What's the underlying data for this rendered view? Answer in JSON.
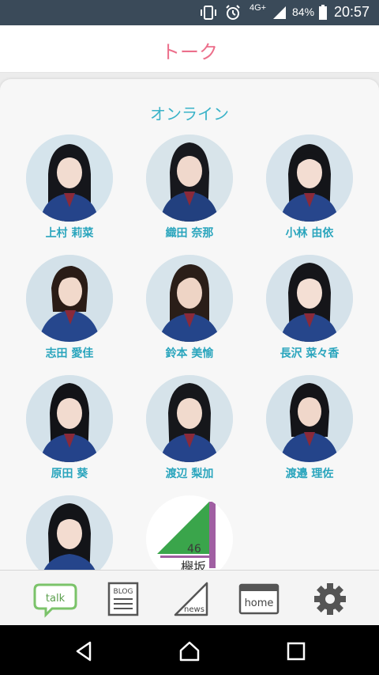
{
  "status_bar": {
    "network": "4G+",
    "battery": "84%",
    "time": "20:57",
    "icons": [
      "vibrate-icon",
      "alarm-icon",
      "signal-icon",
      "battery-icon"
    ]
  },
  "header": {
    "title": "トーク"
  },
  "section": {
    "title": "オンライン"
  },
  "members": [
    {
      "name": "上村 莉菜"
    },
    {
      "name": "織田 奈那"
    },
    {
      "name": "小林 由依"
    },
    {
      "name": "志田 愛佳"
    },
    {
      "name": "鈴本 美愉"
    },
    {
      "name": "長沢 菜々香"
    },
    {
      "name": "原田 葵"
    },
    {
      "name": "渡辺 梨加"
    },
    {
      "name": "渡邉 理佐"
    },
    {
      "name": ""
    }
  ],
  "logo": {
    "number": "46",
    "text": "欅坂"
  },
  "tabs": [
    {
      "label": "talk",
      "icon": "talk-icon"
    },
    {
      "label": "BLOG",
      "icon": "blog-icon"
    },
    {
      "label": "news",
      "icon": "news-icon"
    },
    {
      "label": "home",
      "icon": "home-icon"
    },
    {
      "label": "",
      "icon": "settings-gear-icon"
    }
  ],
  "colors": {
    "status_bar": "#3a4a59",
    "header_title": "#ec6f8b",
    "section_title": "#3ab3c8",
    "member_name": "#2aa5bd",
    "talk_active": "#7bc36a",
    "logo_green": "#3aa54b",
    "logo_purple": "#a05fa2"
  }
}
